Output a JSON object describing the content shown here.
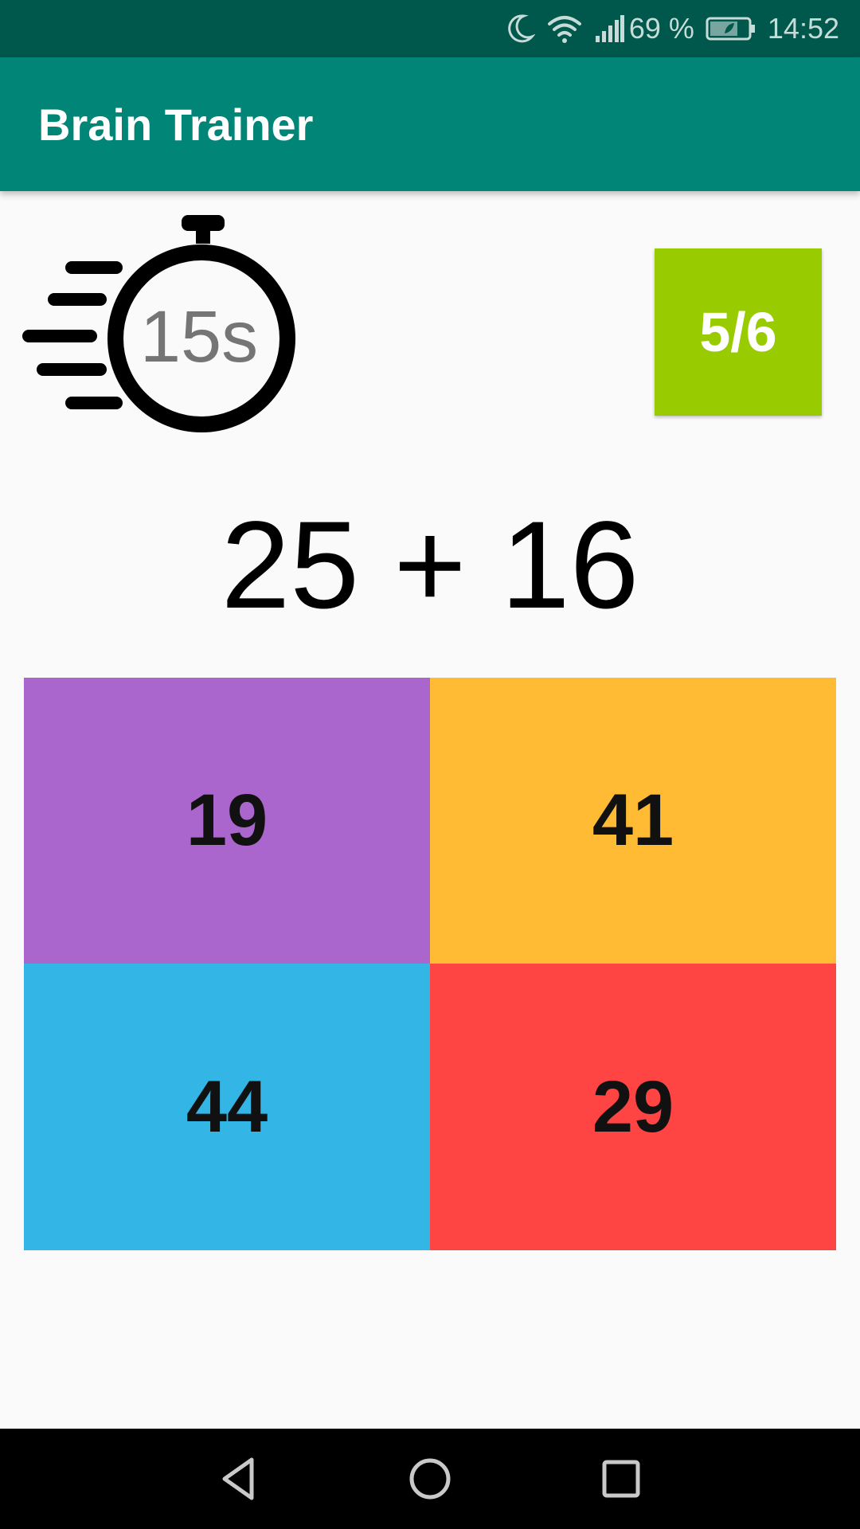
{
  "status_bar": {
    "battery_percent": "69 %",
    "time": "14:52",
    "icons": [
      "moon-icon",
      "wifi-icon",
      "signal-icon",
      "battery-icon"
    ]
  },
  "app_bar": {
    "title": "Brain Trainer"
  },
  "timer": {
    "label": "15s",
    "icon": "stopwatch-icon"
  },
  "score": {
    "label": "5/6",
    "color": "#99cc00"
  },
  "question": {
    "text": "25 + 16"
  },
  "answers": [
    {
      "label": "19",
      "color": "#aa66cc"
    },
    {
      "label": "41",
      "color": "#ffbb33"
    },
    {
      "label": "44",
      "color": "#33b5e5"
    },
    {
      "label": "29",
      "color": "#ff4444"
    }
  ],
  "nav_bar": {
    "buttons": [
      "back-icon",
      "home-icon",
      "recents-icon"
    ]
  }
}
